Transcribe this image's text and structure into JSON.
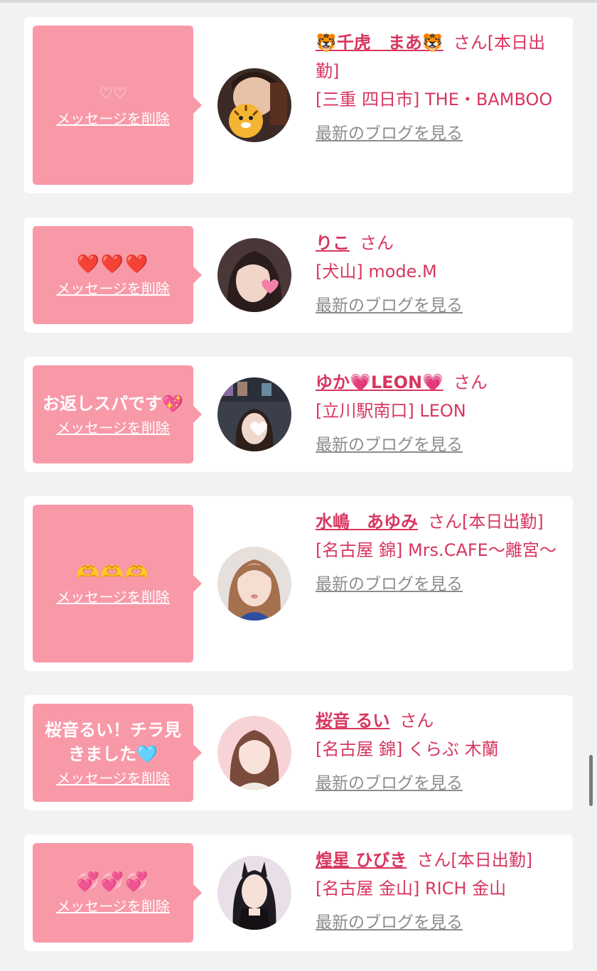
{
  "delete_label": "メッセージを削除",
  "blog_label": "最新のブログを見る",
  "honorific": "さん",
  "cards": [
    {
      "message": "♡♡",
      "name": "🐯千虎　まあ🐯",
      "status": "[本日出勤]",
      "shop": "[三重 四日市] THE・BAMBOO",
      "avatar_icon": "tiger-emoji-icon",
      "avatar_color": "#6b3a2a"
    },
    {
      "message": "❤️❤️❤️",
      "name": "りこ",
      "status": "",
      "shop": "[犬山] mode.M",
      "avatar_icon": "heart-sticker-icon",
      "avatar_color": "#4a3a3a"
    },
    {
      "message": "お返しスパです💖",
      "name": "ゆか💗LEON💗",
      "status": "",
      "shop": "[立川駅南口] LEON",
      "avatar_icon": "heart-sticker-icon",
      "avatar_color": "#3a3f4a"
    },
    {
      "message": "🫶🫶🫶",
      "name": "水嶋　あゆみ",
      "status": "[本日出勤]",
      "shop": "[名古屋 錦] Mrs.CAFE〜離宮〜",
      "avatar_icon": "portrait-photo-icon",
      "avatar_color": "#b08a78"
    },
    {
      "message": "桜音るい！チラ見きました🩵",
      "name": "桜音 るい",
      "status": "",
      "shop": "[名古屋 錦] くらぶ 木蘭",
      "avatar_icon": "portrait-photo-icon",
      "avatar_color": "#f2c9cf"
    },
    {
      "message": "💞💞💞",
      "name": "煌星 ひびき",
      "status": "[本日出勤]",
      "shop": "[名古屋 金山] RICH 金山",
      "avatar_icon": "portrait-photo-icon",
      "avatar_color": "#c9b3c8"
    }
  ]
}
